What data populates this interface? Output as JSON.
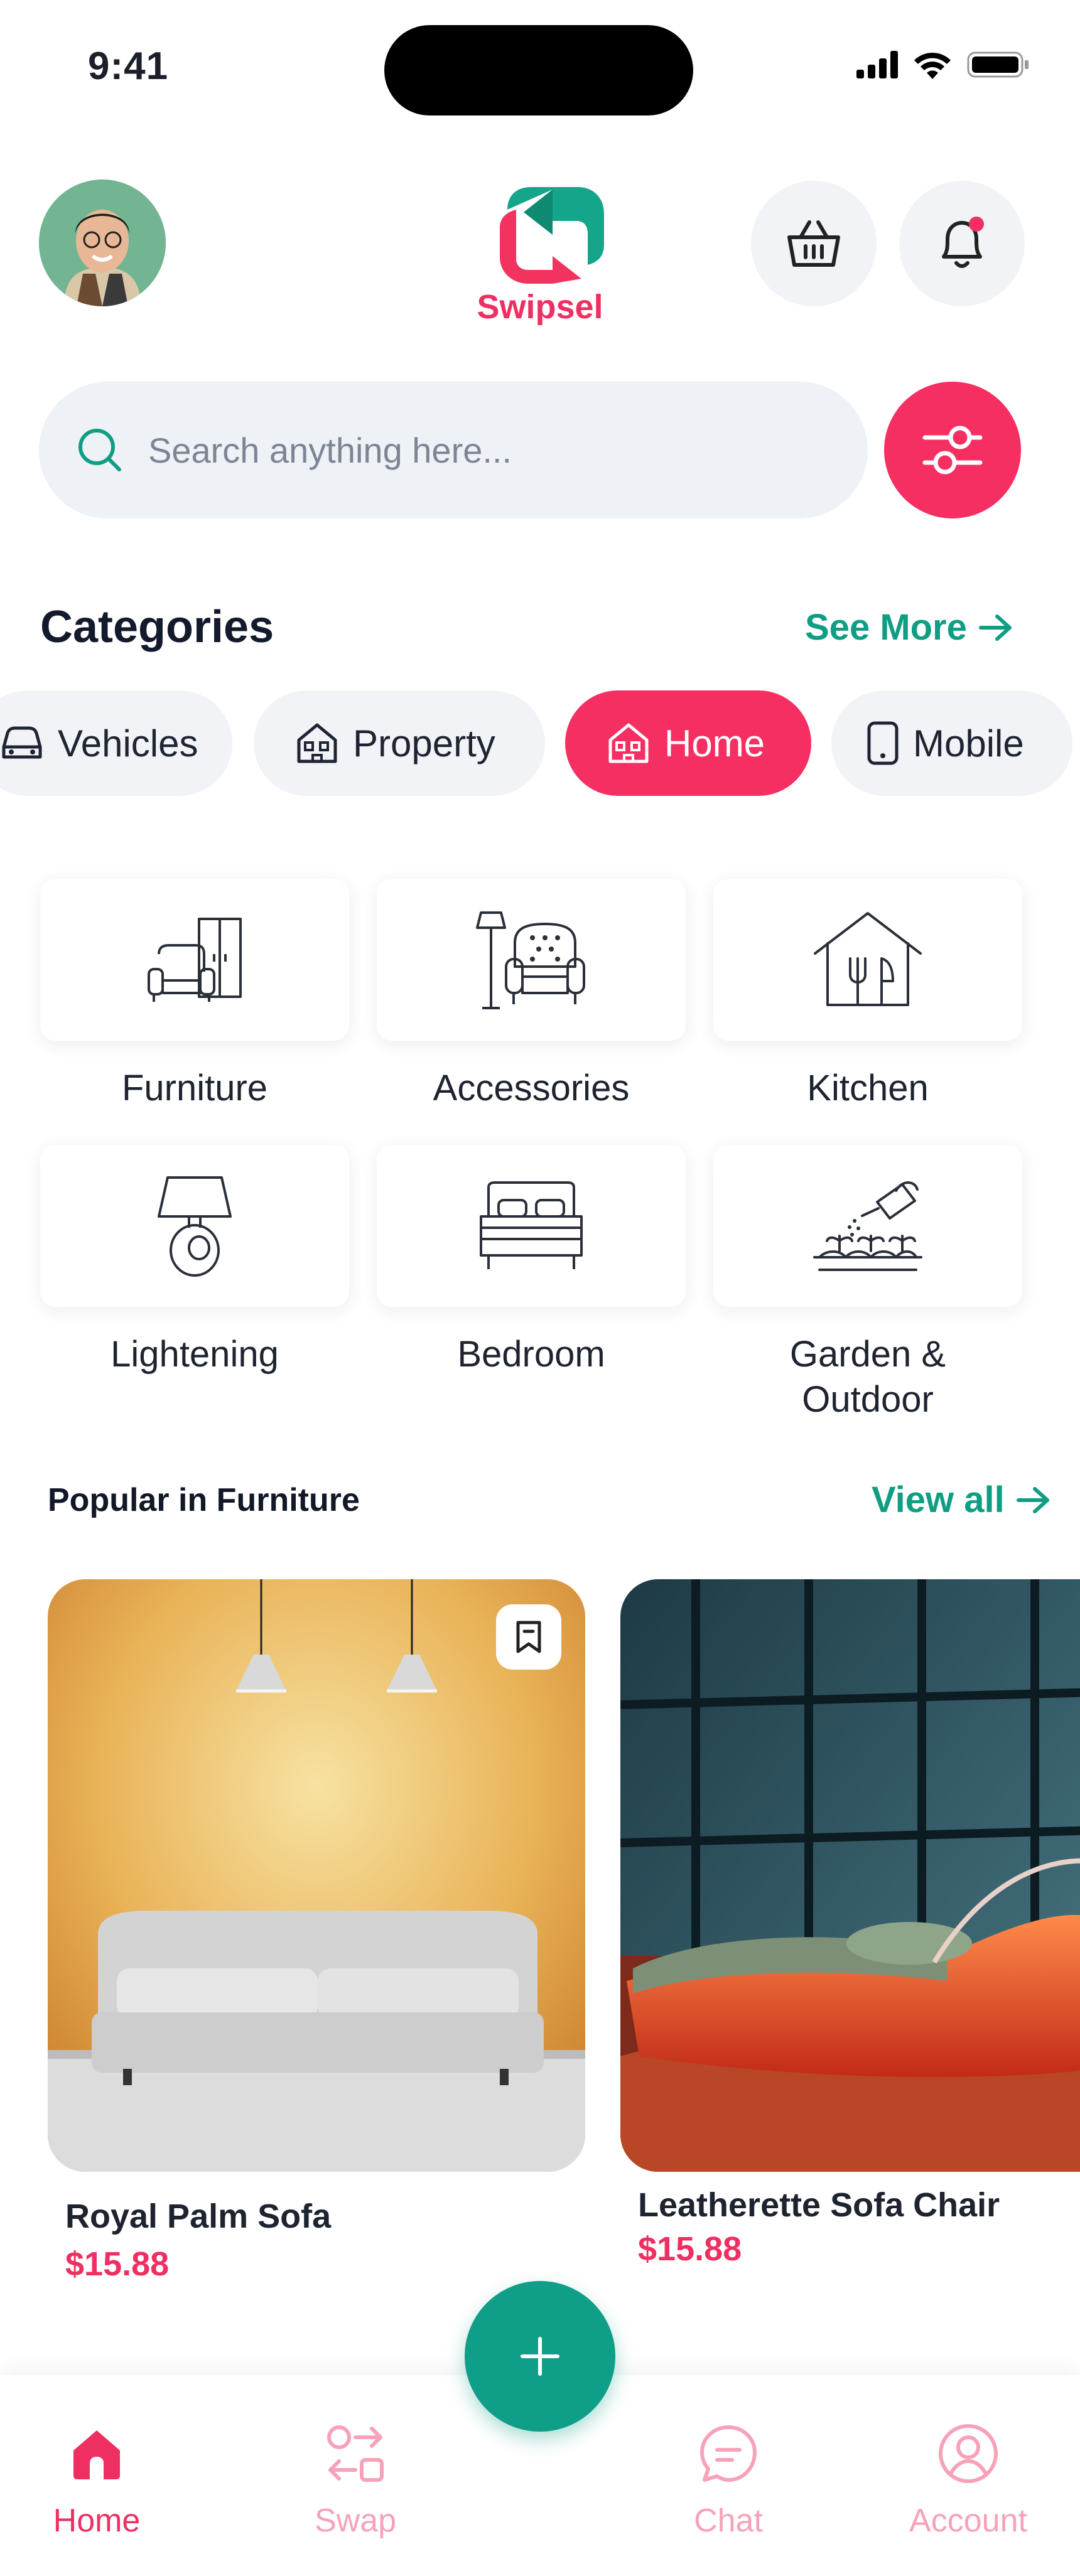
{
  "status": {
    "time": "9:41"
  },
  "brand": {
    "name": "Swipsel"
  },
  "search": {
    "placeholder": "Search anything here..."
  },
  "categories": {
    "title": "Categories",
    "see_more": "See More",
    "chips": [
      {
        "label": "Vehicles",
        "icon": "car-icon",
        "active": false
      },
      {
        "label": "Property",
        "icon": "house-icon",
        "active": false
      },
      {
        "label": "Home",
        "icon": "home-icon",
        "active": true
      },
      {
        "label": "Mobile",
        "icon": "phone-icon",
        "active": false
      }
    ],
    "subcategories": [
      {
        "label": "Furniture",
        "icon": "armchair-cabinet-icon"
      },
      {
        "label": "Accessories",
        "icon": "lamp-chair-icon"
      },
      {
        "label": "Kitchen",
        "icon": "kitchen-house-icon"
      },
      {
        "label": "Lightening",
        "icon": "table-lamp-icon"
      },
      {
        "label": "Bedroom",
        "icon": "bed-icon"
      },
      {
        "label": "Garden & Outdoor",
        "icon": "watering-can-icon"
      }
    ]
  },
  "popular": {
    "title": "Popular in Furniture",
    "view_all": "View all",
    "products": [
      {
        "name": "Royal Palm Sofa",
        "price": "$15.88"
      },
      {
        "name": "Leatherette Sofa Chair",
        "price": "$15.88"
      }
    ]
  },
  "nav": {
    "items": [
      {
        "label": "Home",
        "icon": "home-icon",
        "active": true
      },
      {
        "label": "Swap",
        "icon": "swap-icon",
        "active": false
      },
      {
        "label": "Chat",
        "icon": "chat-icon",
        "active": false
      },
      {
        "label": "Account",
        "icon": "account-icon",
        "active": false
      }
    ]
  },
  "colors": {
    "accent": "#f52f62",
    "primary": "#0f9e83",
    "surface": "#f1f3f7"
  }
}
